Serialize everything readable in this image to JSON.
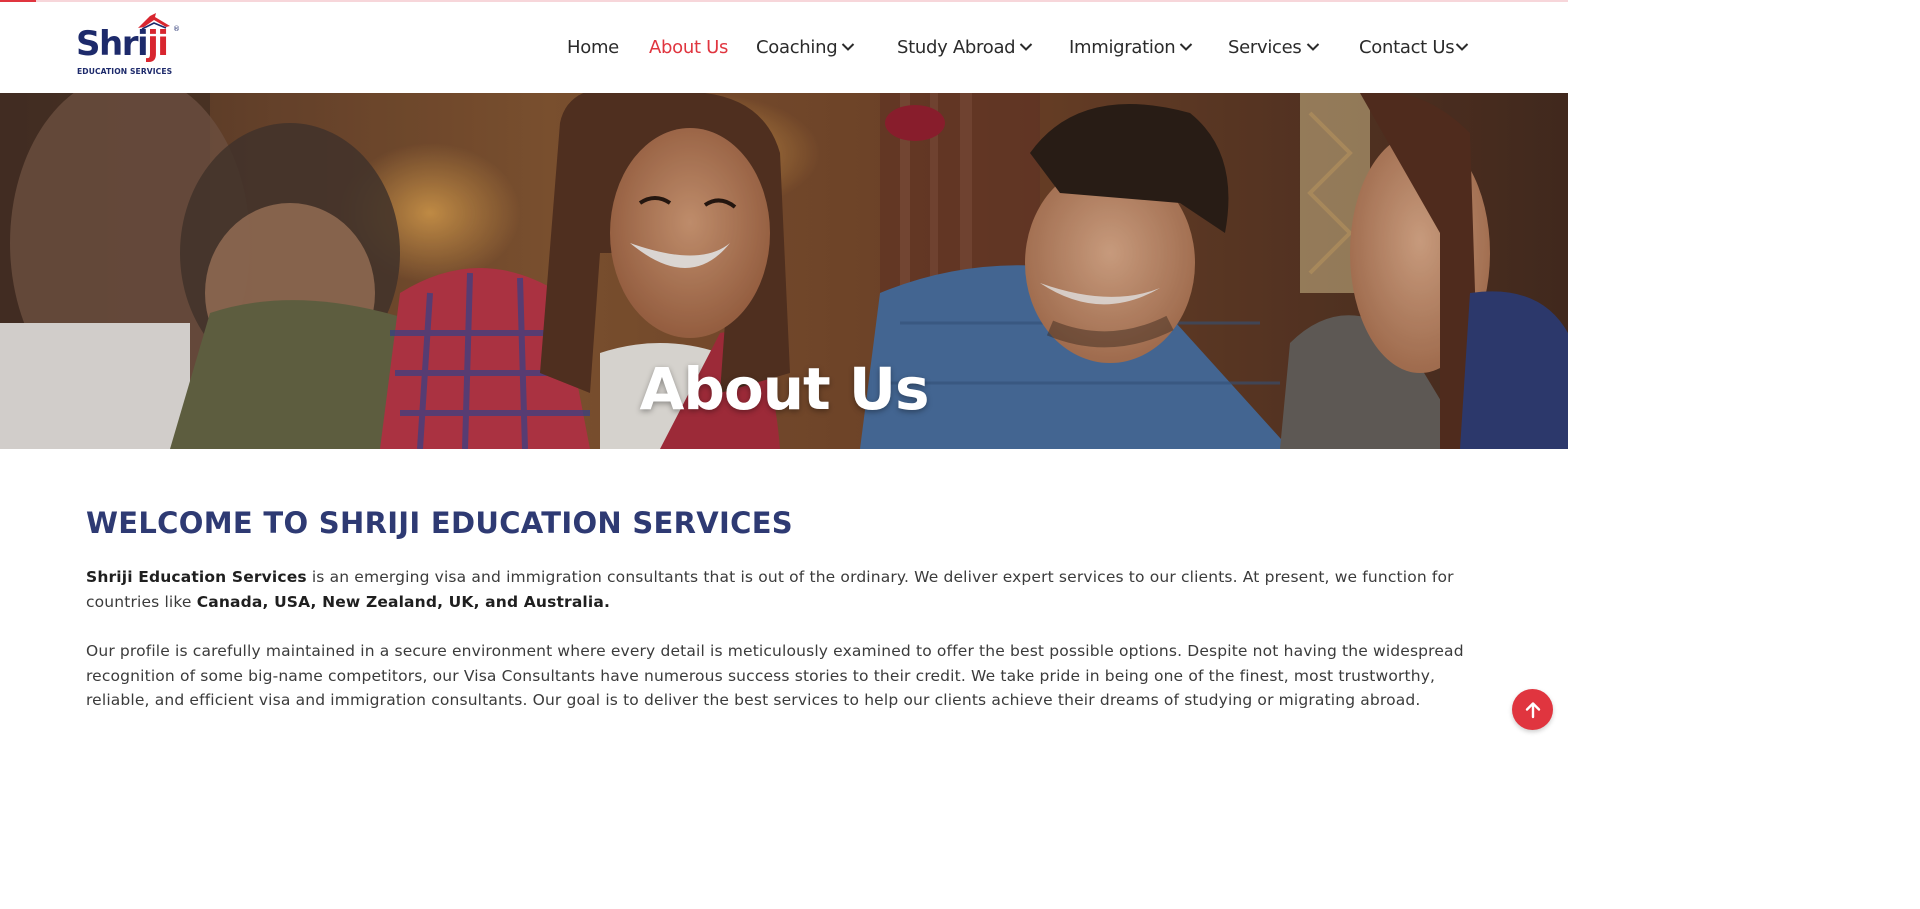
{
  "brand": {
    "name_part1": "Shri",
    "name_part2": "ji",
    "tagline": "EDUCATION SERVICES",
    "reg_mark": "®",
    "primary_color": "#1d2a6b",
    "accent_color": "#d8262f"
  },
  "nav": {
    "items": [
      {
        "label": "Home",
        "active": false,
        "dropdown": false
      },
      {
        "label": "About Us",
        "active": true,
        "dropdown": false
      },
      {
        "label": "Coaching",
        "active": false,
        "dropdown": true
      },
      {
        "label": "Study Abroad",
        "active": false,
        "dropdown": true
      },
      {
        "label": "Immigration",
        "active": false,
        "dropdown": true
      },
      {
        "label": "Services",
        "active": false,
        "dropdown": true
      },
      {
        "label": "Contact Us",
        "active": false,
        "dropdown": true
      }
    ],
    "active_color": "#e0353f"
  },
  "hero": {
    "title": "About Us"
  },
  "main": {
    "heading": "WELCOME TO SHRIJI EDUCATION SERVICES",
    "p1": {
      "bold_lead": "Shriji Education Services",
      "text": " is an emerging visa and immigration consultants that is out of the ordinary. We deliver expert services to our clients. At present, we function for countries like ",
      "bold_tail": "Canada, USA, New Zealand, UK, and Australia."
    },
    "p2": "Our profile is carefully maintained in a secure environment where every detail is meticulously examined to offer the best possible options. Despite not having the widespread recognition of some big-name competitors, our Visa Consultants have numerous success stories to their credit. We take pride in being one of the finest, most trustworthy, reliable, and efficient visa and immigration consultants. Our goal is to deliver the best services to help our clients achieve their dreams of studying or migrating abroad."
  },
  "icons": {
    "scroll_top": "arrow-up-icon",
    "dropdown": "chevron-down-icon"
  }
}
